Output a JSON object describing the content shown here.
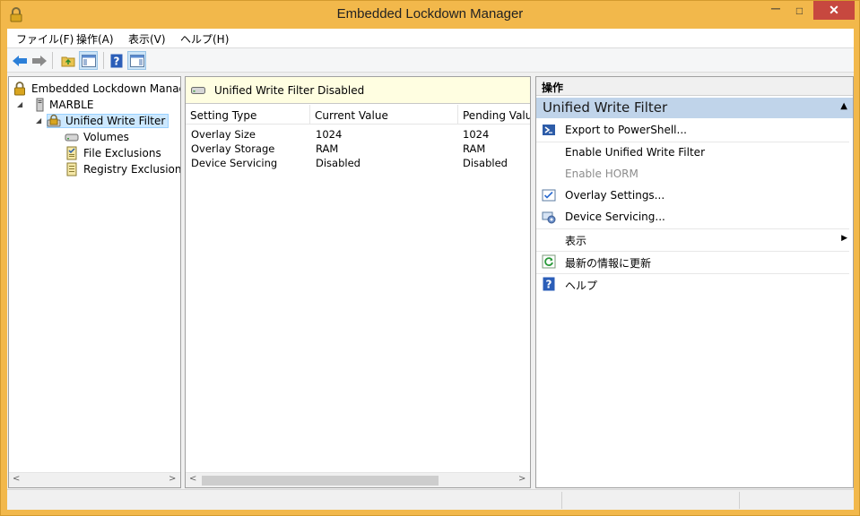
{
  "window": {
    "title": "Embedded Lockdown Manager",
    "minimize_glyph": "─",
    "maximize_glyph": "□",
    "close_glyph": "✕"
  },
  "menu": [
    "ファイル(F)",
    "操作(A)",
    "表示(V)",
    "ヘルプ(H)"
  ],
  "toolbar": {
    "buttons": [
      "back-arrow-icon",
      "forward-arrow-icon",
      "up-folder-icon",
      "show-hide-console-tree-icon",
      "help-icon",
      "show-hide-action-pane-icon"
    ]
  },
  "tree": {
    "root": "Embedded Lockdown Manag",
    "machine": "MARBLE",
    "feature": "Unified Write Filter",
    "children": [
      "Volumes",
      "File Exclusions",
      "Registry Exclusions"
    ]
  },
  "middle": {
    "status_text": "Unified Write Filter Disabled",
    "columns": [
      "Setting Type",
      "Current Value",
      "Pending Value"
    ],
    "rows": [
      [
        "Overlay Size",
        "1024",
        "1024"
      ],
      [
        "Overlay Storage",
        "RAM",
        "RAM"
      ],
      [
        "Device Servicing",
        "Disabled",
        "Disabled"
      ]
    ]
  },
  "actions": {
    "header": "操作",
    "section_title": "Unified Write Filter",
    "items": [
      {
        "label": "Export to PowerShell...",
        "icon": "powershell-icon",
        "enabled": true
      },
      {
        "label": "Enable Unified Write Filter",
        "icon": "",
        "enabled": true
      },
      {
        "label": "Enable HORM",
        "icon": "",
        "enabled": false
      },
      {
        "label": "Overlay Settings...",
        "icon": "overlay-settings-icon",
        "enabled": true
      },
      {
        "label": "Device Servicing...",
        "icon": "device-servicing-icon",
        "enabled": true
      },
      {
        "label": "表示",
        "icon": "",
        "enabled": true,
        "submenu": true
      },
      {
        "label": "最新の情報に更新",
        "icon": "refresh-icon",
        "enabled": true
      },
      {
        "label": "ヘルプ",
        "icon": "help-icon",
        "enabled": true
      }
    ]
  }
}
